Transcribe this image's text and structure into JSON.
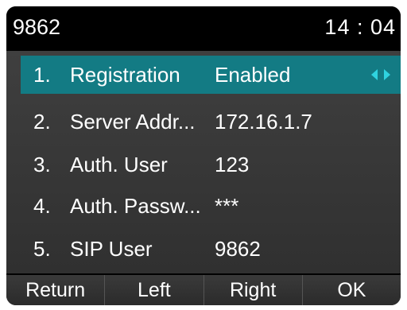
{
  "status_bar": {
    "account": "9862",
    "time": "14 : 04"
  },
  "menu": {
    "items": [
      {
        "number": "1.",
        "label": "Registration",
        "value": "Enabled",
        "selected": true
      },
      {
        "number": "2.",
        "label": "Server Addr...",
        "value": "172.16.1.7",
        "selected": false
      },
      {
        "number": "3.",
        "label": "Auth. User",
        "value": "123",
        "selected": false
      },
      {
        "number": "4.",
        "label": "Auth. Passw...",
        "value": "***",
        "selected": false
      },
      {
        "number": "5.",
        "label": "SIP User",
        "value": "9862",
        "selected": false
      }
    ],
    "selector_icons": [
      "arrow-left-icon",
      "arrow-right-icon"
    ]
  },
  "softkeys": {
    "return_label": "Return",
    "left_label": "Left",
    "right_label": "Right",
    "ok_label": "OK"
  },
  "colors": {
    "screen_background": "#000000",
    "menu_background": "#363636",
    "selected_row": "#137b84",
    "arrow_icon": "#2fd3e0",
    "text": "#ffffff"
  }
}
